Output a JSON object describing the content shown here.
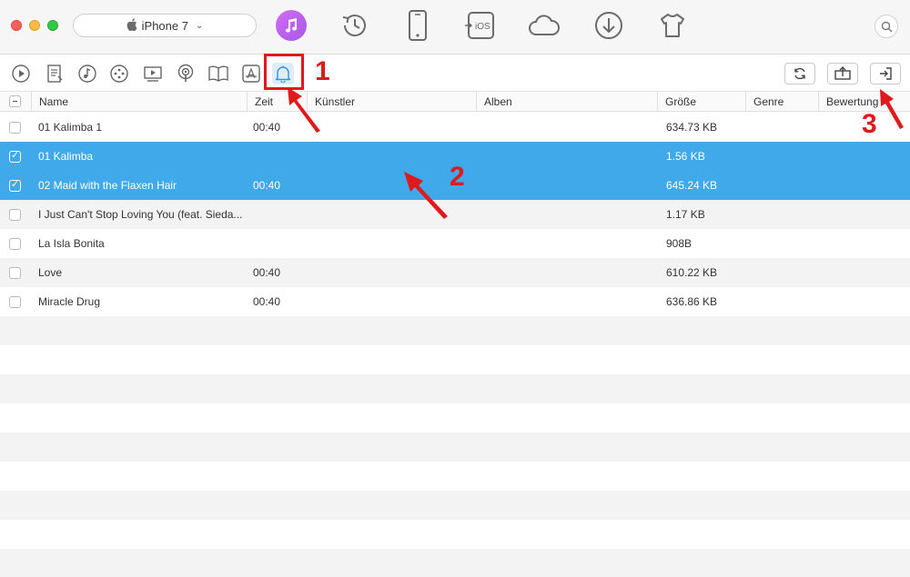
{
  "device": {
    "name": "iPhone 7"
  },
  "top_nav": [
    {
      "icon": "music-icon",
      "active": true
    },
    {
      "icon": "history-icon"
    },
    {
      "icon": "phone-icon"
    },
    {
      "icon": "ios-icon",
      "label": "iOS"
    },
    {
      "icon": "cloud-icon"
    },
    {
      "icon": "download-icon"
    },
    {
      "icon": "tshirt-icon"
    }
  ],
  "categories": [
    "music-play-icon",
    "playlist-icon",
    "audio-icon",
    "gamepad-icon",
    "video-icon",
    "podcast-icon",
    "book-icon",
    "app-store-icon",
    "ringtone-bell-icon"
  ],
  "active_category": "ringtone-bell-icon",
  "actions": [
    "refresh-icon",
    "to-computer-icon",
    "import-icon"
  ],
  "table": {
    "columns": [
      "Name",
      "Zeit",
      "Künstler",
      "Alben",
      "Größe",
      "Genre",
      "Bewertung"
    ],
    "rows": [
      {
        "checked": false,
        "name": "01 Kalimba 1",
        "time": "00:40",
        "artist": "",
        "album": "",
        "size": "634.73 KB"
      },
      {
        "checked": true,
        "name": "01 Kalimba",
        "time": "",
        "artist": "",
        "album": "",
        "size": "1.56 KB"
      },
      {
        "checked": true,
        "name": "02 Maid with the Flaxen Hair",
        "time": "00:40",
        "artist": "",
        "album": "",
        "size": "645.24 KB"
      },
      {
        "checked": false,
        "name": "I Just Can't Stop Loving You (feat. Sieda...",
        "time": "",
        "artist": "",
        "album": "",
        "size": "1.17 KB"
      },
      {
        "checked": false,
        "name": "La Isla Bonita",
        "time": "",
        "artist": "",
        "album": "",
        "size": "908B"
      },
      {
        "checked": false,
        "name": "Love",
        "time": "00:40",
        "artist": "",
        "album": "",
        "size": "610.22 KB"
      },
      {
        "checked": false,
        "name": "Miracle Drug",
        "time": "00:40",
        "artist": "",
        "album": "",
        "size": "636.86 KB"
      }
    ]
  },
  "annotations": [
    "1",
    "2",
    "3"
  ],
  "colors": {
    "selection": "#3fa9ea",
    "accent_red": "#e0191b",
    "music_gradient_start": "#d46bf5",
    "music_gradient_end": "#a55ae6"
  }
}
